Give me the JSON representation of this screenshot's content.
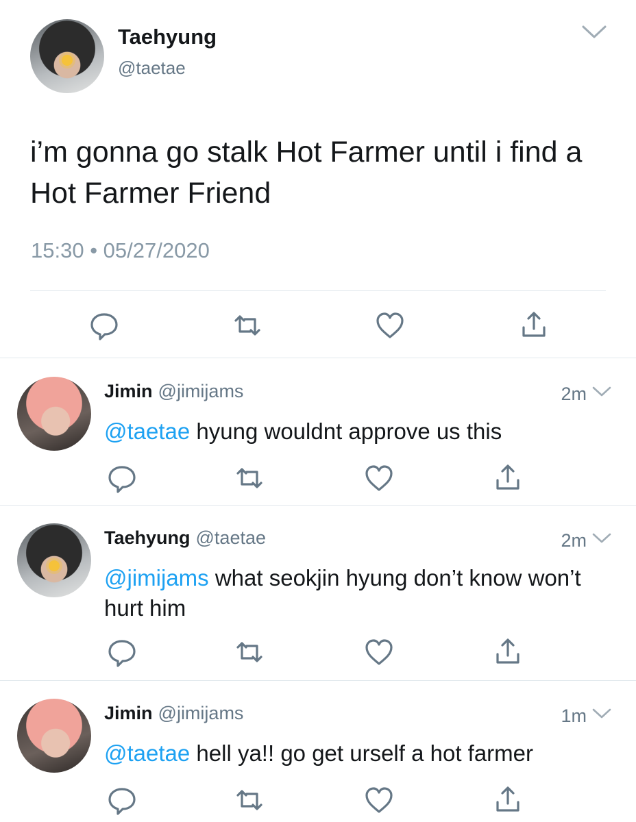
{
  "main": {
    "name": "Taehyung",
    "handle": "@taetae",
    "text": "i’m gonna go stalk Hot Farmer until i find a Hot Farmer Friend",
    "timestamp": "15:30 • 05/27/2020"
  },
  "replies": [
    {
      "name": "Jimin",
      "handle": "@jimijams",
      "time": "2m",
      "mention": "@taetae",
      "text": " hyung wouldnt approve us this"
    },
    {
      "name": "Taehyung",
      "handle": "@taetae",
      "time": "2m",
      "mention": "@jimijams",
      "text": " what seokjin hyung don’t know won’t hurt him"
    },
    {
      "name": "Jimin",
      "handle": "@jimijams",
      "time": "1m",
      "mention": "@taetae",
      "text": " hell ya!! go get urself a hot farmer"
    }
  ],
  "icons": [
    "chevron-down-icon",
    "reply-icon",
    "retweet-icon",
    "like-icon",
    "share-icon"
  ],
  "colors": {
    "text": "#14171a",
    "secondary": "#657786",
    "timestamp": "#8899a6",
    "mention": "#1da1f2",
    "icon": "#657786",
    "divider": "#e1e8ed"
  }
}
